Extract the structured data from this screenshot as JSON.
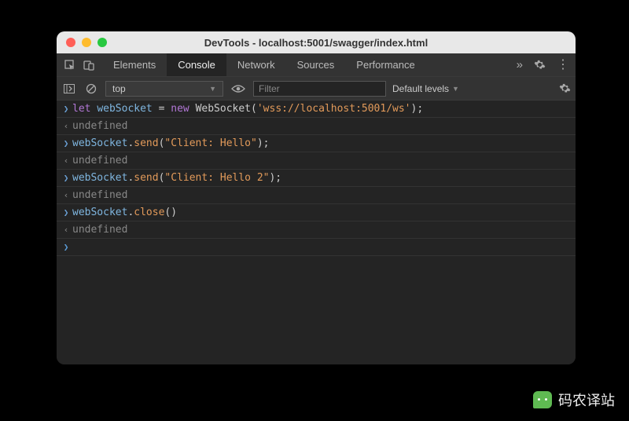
{
  "window": {
    "title": "DevTools - localhost:5001/swagger/index.html"
  },
  "tabs": [
    {
      "label": "Elements",
      "active": false
    },
    {
      "label": "Console",
      "active": true
    },
    {
      "label": "Network",
      "active": false
    },
    {
      "label": "Sources",
      "active": false
    },
    {
      "label": "Performance",
      "active": false
    }
  ],
  "filterbar": {
    "context": "top",
    "filter_placeholder": "Filter",
    "levels": "Default levels"
  },
  "console_entries": [
    {
      "dir": "in",
      "tokens": [
        {
          "t": "kw",
          "v": "let "
        },
        {
          "t": "var",
          "v": "webSocket"
        },
        {
          "t": "op",
          "v": " = "
        },
        {
          "t": "new",
          "v": "new "
        },
        {
          "t": "cls",
          "v": "WebSocket("
        },
        {
          "t": "str",
          "v": "'wss://localhost:5001/ws'"
        },
        {
          "t": "cls",
          "v": ");"
        }
      ]
    },
    {
      "dir": "out",
      "tokens": [
        {
          "t": "undef",
          "v": "undefined"
        }
      ]
    },
    {
      "dir": "in",
      "tokens": [
        {
          "t": "var",
          "v": "webSocket"
        },
        {
          "t": "op",
          "v": "."
        },
        {
          "t": "fn",
          "v": "send"
        },
        {
          "t": "op",
          "v": "("
        },
        {
          "t": "str",
          "v": "\"Client: Hello\""
        },
        {
          "t": "op",
          "v": ");"
        }
      ]
    },
    {
      "dir": "out",
      "tokens": [
        {
          "t": "undef",
          "v": "undefined"
        }
      ]
    },
    {
      "dir": "in",
      "tokens": [
        {
          "t": "var",
          "v": "webSocket"
        },
        {
          "t": "op",
          "v": "."
        },
        {
          "t": "fn",
          "v": "send"
        },
        {
          "t": "op",
          "v": "("
        },
        {
          "t": "str",
          "v": "\"Client: Hello 2\""
        },
        {
          "t": "op",
          "v": ");"
        }
      ]
    },
    {
      "dir": "out",
      "tokens": [
        {
          "t": "undef",
          "v": "undefined"
        }
      ]
    },
    {
      "dir": "in",
      "tokens": [
        {
          "t": "var",
          "v": "webSocket"
        },
        {
          "t": "op",
          "v": "."
        },
        {
          "t": "fn",
          "v": "close"
        },
        {
          "t": "op",
          "v": "()"
        }
      ]
    },
    {
      "dir": "out",
      "tokens": [
        {
          "t": "undef",
          "v": "undefined"
        }
      ]
    }
  ],
  "watermark": {
    "text": "码农译站"
  }
}
